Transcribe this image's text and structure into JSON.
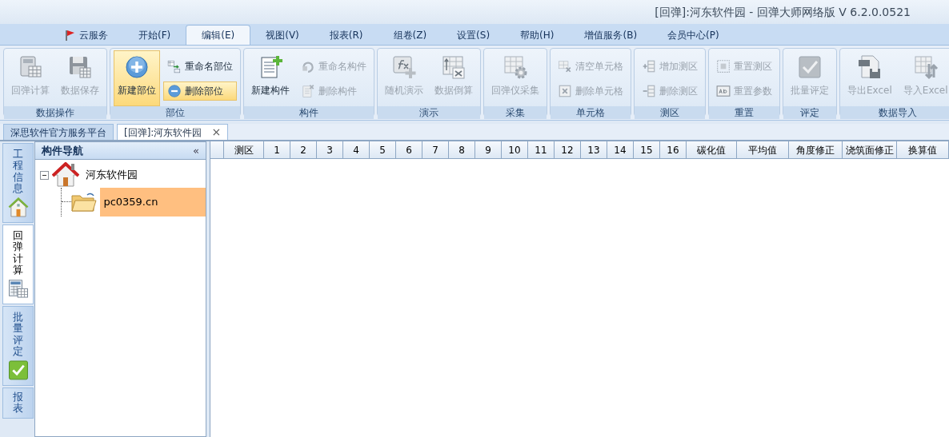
{
  "window": {
    "title": "[回弹]:河东软件园 - 回弹大师网络版 V 6.2.0.0521"
  },
  "menu_tabs": [
    {
      "label": "云服务",
      "selected": false
    },
    {
      "label": "开始(F)",
      "selected": false
    },
    {
      "label": "编辑(E)",
      "selected": true
    },
    {
      "label": "视图(V)",
      "selected": false
    },
    {
      "label": "报表(R)",
      "selected": false
    },
    {
      "label": "组卷(Z)",
      "selected": false
    },
    {
      "label": "设置(S)",
      "selected": false
    },
    {
      "label": "帮助(H)",
      "selected": false
    },
    {
      "label": "增值服务(B)",
      "selected": false
    },
    {
      "label": "会员中心(P)",
      "selected": false
    }
  ],
  "ribbon_groups": [
    {
      "title": "数据操作",
      "buttons": [
        {
          "kind": "large",
          "label": "回弹计算",
          "disabled": true,
          "highlighted": false
        },
        {
          "kind": "large",
          "label": "数据保存",
          "disabled": true,
          "highlighted": false
        }
      ]
    },
    {
      "title": "部位",
      "buttons": [
        {
          "kind": "large",
          "label": "新建部位",
          "disabled": false,
          "highlighted": true
        },
        {
          "kind": "small",
          "label": "重命名部位",
          "disabled": false,
          "highlighted": false
        },
        {
          "kind": "small",
          "label": "删除部位",
          "disabled": false,
          "highlighted": true
        }
      ]
    },
    {
      "title": "构件",
      "buttons": [
        {
          "kind": "large",
          "label": "新建构件",
          "disabled": false,
          "highlighted": false
        },
        {
          "kind": "small",
          "label": "重命名构件",
          "disabled": true,
          "highlighted": false
        },
        {
          "kind": "small",
          "label": "删除构件",
          "disabled": true,
          "highlighted": false
        }
      ]
    },
    {
      "title": "演示",
      "buttons": [
        {
          "kind": "large",
          "label": "随机演示",
          "disabled": true,
          "highlighted": false
        },
        {
          "kind": "large",
          "label": "数据倒算",
          "disabled": true,
          "highlighted": false
        }
      ]
    },
    {
      "title": "采集",
      "buttons": [
        {
          "kind": "large",
          "label": "回弹仪采集",
          "disabled": true,
          "highlighted": false
        }
      ]
    },
    {
      "title": "单元格",
      "buttons": [
        {
          "kind": "small",
          "label": "清空单元格",
          "disabled": true,
          "highlighted": false
        },
        {
          "kind": "small",
          "label": "删除单元格",
          "disabled": true,
          "highlighted": false
        }
      ]
    },
    {
      "title": "测区",
      "buttons": [
        {
          "kind": "small",
          "label": "增加测区",
          "disabled": true,
          "highlighted": false
        },
        {
          "kind": "small",
          "label": "删除测区",
          "disabled": true,
          "highlighted": false
        }
      ]
    },
    {
      "title": "重置",
      "buttons": [
        {
          "kind": "small",
          "label": "重置测区",
          "disabled": true,
          "highlighted": false
        },
        {
          "kind": "small",
          "label": "重置参数",
          "disabled": true,
          "highlighted": false
        }
      ]
    },
    {
      "title": "评定",
      "buttons": [
        {
          "kind": "large",
          "label": "批量评定",
          "disabled": true,
          "highlighted": false
        }
      ]
    },
    {
      "title": "数据导入",
      "buttons": [
        {
          "kind": "large",
          "label": "导出Excel",
          "disabled": true,
          "highlighted": false
        },
        {
          "kind": "large",
          "label": "导入Excel",
          "disabled": true,
          "highlighted": false
        }
      ]
    }
  ],
  "document_tabs": [
    {
      "label": "深思软件官方服务平台",
      "selected": false,
      "closable": false
    },
    {
      "label": "[回弹]:河东软件园",
      "selected": true,
      "closable": true,
      "close": "×"
    }
  ],
  "side_tabs": [
    {
      "label": "工程信息",
      "selected": false
    },
    {
      "label": "回弹计算",
      "selected": true
    },
    {
      "label": "批量评定",
      "selected": false
    },
    {
      "label": "报表",
      "selected": false
    }
  ],
  "navigator": {
    "title": "构件导航",
    "collapse": "«",
    "tree": [
      {
        "label": "河东软件园",
        "expanded": true,
        "selected": false,
        "children": [
          {
            "label": "pc0359.cn",
            "selected": true
          }
        ]
      }
    ]
  },
  "table": {
    "columns": [
      "",
      "测区",
      "1",
      "2",
      "3",
      "4",
      "5",
      "6",
      "7",
      "8",
      "9",
      "10",
      "11",
      "12",
      "13",
      "14",
      "15",
      "16",
      "碳化值",
      "平均值",
      "角度修正",
      "浇筑面修正",
      "换算值"
    ]
  }
}
